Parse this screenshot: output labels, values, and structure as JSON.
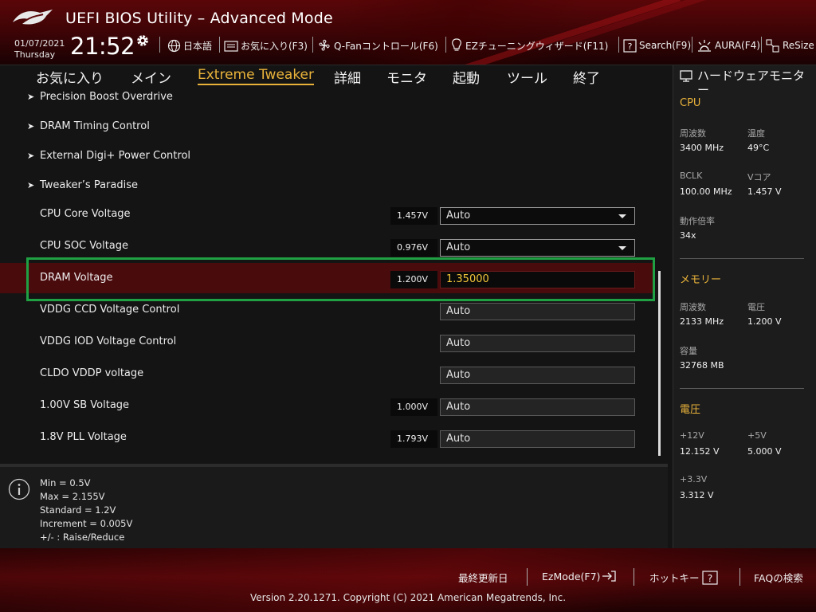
{
  "header": {
    "title": "UEFI BIOS Utility – Advanced Mode",
    "date": "01/07/2021",
    "day": "Thursday",
    "time": "21:52",
    "items": [
      {
        "label": "日本語",
        "icon": "globe-icon"
      },
      {
        "label": "お気に入り(F3)",
        "icon": "favorites-folder-icon"
      },
      {
        "label": "Q-Fanコントロール(F6)",
        "icon": "fan-icon"
      },
      {
        "label": "EZチューニングウィザード(F11)",
        "icon": "lightbulb-icon"
      },
      {
        "label": "Search(F9)",
        "icon": "question-box-icon"
      },
      {
        "label": "AURA(F4)",
        "icon": "aura-icon"
      },
      {
        "label": "ReSize",
        "icon": "resize-icon"
      }
    ]
  },
  "tabs": [
    {
      "label": "お気に入り"
    },
    {
      "label": "メイン"
    },
    {
      "label": "Extreme Tweaker",
      "active": true
    },
    {
      "label": "詳細"
    },
    {
      "label": "モニタ"
    },
    {
      "label": "起動"
    },
    {
      "label": "ツール"
    },
    {
      "label": "終了"
    }
  ],
  "submenus": [
    "Precision Boost Overdrive",
    "DRAM Timing Control",
    "External Digi+ Power Control",
    "Tweaker’s Paradise"
  ],
  "voltages": [
    {
      "label": "CPU Core Voltage",
      "current": "1.457V",
      "value": "Auto",
      "type": "dropdown"
    },
    {
      "label": "CPU SOC Voltage",
      "current": "0.976V",
      "value": "Auto",
      "type": "dropdown"
    },
    {
      "label": "DRAM Voltage",
      "current": "1.200V",
      "value": "1.35000",
      "type": "input-active"
    },
    {
      "label": "VDDG CCD Voltage Control",
      "current": "",
      "value": "Auto",
      "type": "input"
    },
    {
      "label": "VDDG IOD Voltage Control",
      "current": "",
      "value": "Auto",
      "type": "input"
    },
    {
      "label": "CLDO VDDP voltage",
      "current": "",
      "value": "Auto",
      "type": "input"
    },
    {
      "label": "1.00V SB Voltage",
      "current": "1.000V",
      "value": "Auto",
      "type": "input"
    },
    {
      "label": "1.8V PLL Voltage",
      "current": "1.793V",
      "value": "Auto",
      "type": "input"
    }
  ],
  "help": {
    "lines": [
      "Min = 0.5V",
      "Max = 2.155V",
      "Standard = 1.2V",
      "Increment = 0.005V",
      "+/- : Raise/Reduce"
    ]
  },
  "monitor": {
    "title": "ハードウェアモニター",
    "cpu": {
      "heading": "CPU",
      "freq_label": "周波数",
      "freq": "3400 MHz",
      "temp_label": "温度",
      "temp": "49°C",
      "bclk_label": "BCLK",
      "bclk": "100.00 MHz",
      "vcore_label": "Vコア",
      "vcore": "1.457 V",
      "ratio_label": "動作倍率",
      "ratio": "34x"
    },
    "memory": {
      "heading": "メモリー",
      "freq_label": "周波数",
      "freq": "2133 MHz",
      "volt_label": "電圧",
      "volt": "1.200 V",
      "cap_label": "容量",
      "cap": "32768 MB"
    },
    "voltage": {
      "heading": "電圧",
      "v12_label": "+12V",
      "v12": "12.152 V",
      "v5_label": "+5V",
      "v5": "5.000 V",
      "v33_label": "+3.3V",
      "v33": "3.312 V"
    }
  },
  "footer": {
    "last_modified": "最終更新日",
    "ezmode": "EzMode(F7)",
    "hotkeys": "ホットキー",
    "faq": "FAQの検索",
    "copyright": "Version 2.20.1271. Copyright (C) 2021 American Megatrends, Inc."
  },
  "colors": {
    "accent": "#e8b23a",
    "highlight_box": "#1fa043",
    "selected_row": "#4a0b0d"
  }
}
